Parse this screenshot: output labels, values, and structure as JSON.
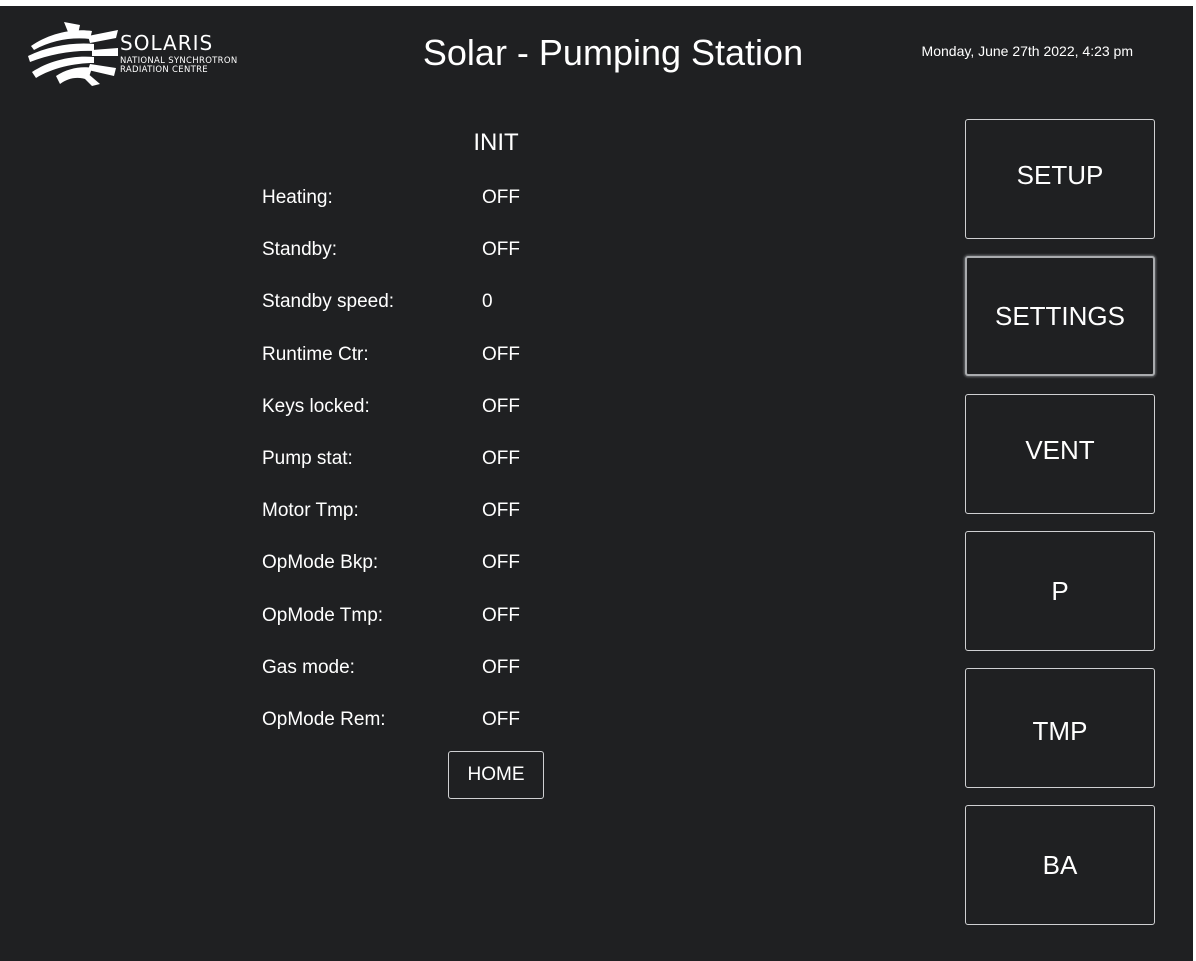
{
  "logo": {
    "name": "SOLARIS",
    "subtitle_line1": "NATIONAL SYNCHROTRON",
    "subtitle_line2": "RADIATION CENTRE",
    "icon": "solaris-fan-logo"
  },
  "header": {
    "title": "Solar - Pumping Station",
    "datetime": "Monday, June 27th 2022, 4:23 pm"
  },
  "status_panel": {
    "state": "INIT",
    "rows": [
      {
        "label": "Heating:",
        "value": "OFF"
      },
      {
        "label": "Standby:",
        "value": "OFF"
      },
      {
        "label": "Standby speed:",
        "value": "0"
      },
      {
        "label": "Runtime Ctr:",
        "value": "OFF"
      },
      {
        "label": "Keys locked:",
        "value": "OFF"
      },
      {
        "label": "Pump stat:",
        "value": "OFF"
      },
      {
        "label": "Motor Tmp:",
        "value": "OFF"
      },
      {
        "label": "OpMode Bkp:",
        "value": "OFF"
      },
      {
        "label": "OpMode Tmp:",
        "value": "OFF"
      },
      {
        "label": "Gas mode:",
        "value": "OFF"
      },
      {
        "label": "OpMode Rem:",
        "value": "OFF"
      }
    ],
    "home_label": "HOME"
  },
  "nav": {
    "setup": "SETUP",
    "settings": "SETTINGS",
    "vent": "VENT",
    "p": "P",
    "tmp": "TMP",
    "ba": "BA",
    "active": "settings"
  },
  "colors": {
    "background": "#1f2022",
    "text": "#ffffff",
    "border": "#cfd0d2"
  }
}
